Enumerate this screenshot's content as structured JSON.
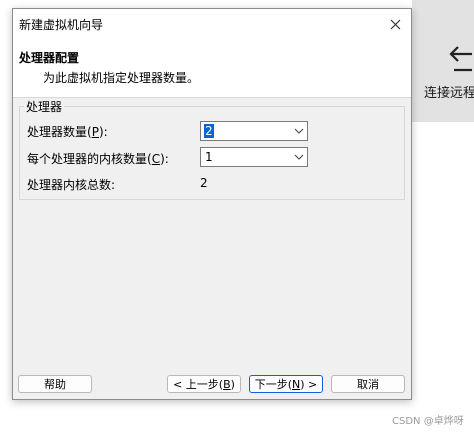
{
  "background": {
    "side_label": "连接远程",
    "watermark": "CSDN @卓烨呀"
  },
  "dialog": {
    "title": "新建虚拟机向导",
    "header_title": "处理器配置",
    "header_subtitle": "为此虚拟机指定处理器数量。",
    "group_title": "处理器",
    "processors": {
      "label": "处理器数量",
      "mnemonic": "P",
      "value": "2"
    },
    "cores": {
      "label": "每个处理器的内核数量",
      "mnemonic": "C",
      "value": "1"
    },
    "total": {
      "label": "处理器内核总数:",
      "value": "2"
    }
  },
  "buttons": {
    "help": "帮助",
    "back_prefix": "< 上一步(",
    "back_key": "B",
    "back_suffix": ")",
    "next_prefix": "下一步(",
    "next_key": "N",
    "next_suffix": ") >",
    "cancel": "取消"
  },
  "colors": {
    "accent": "#0a64d8",
    "dialog_bg": "#f0f0f0"
  },
  "icons": {
    "close": "close-icon",
    "caret": "chevron-down-icon",
    "arrow": "arrow-left-icon"
  }
}
